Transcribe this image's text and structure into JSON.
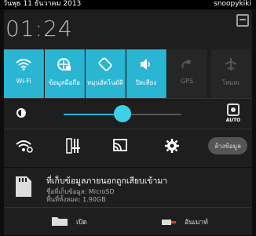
{
  "status": {
    "date": "วันพุธ 11 ธันวาคม 2013",
    "user": "snoopykiki"
  },
  "clock": "01:24",
  "toggles": [
    {
      "label": "Wi-Fi",
      "icon": "wifi-icon",
      "on": true
    },
    {
      "label": "ข้อมูลมือถือ",
      "icon": "mobile-data-icon",
      "on": true
    },
    {
      "label": "หมุนอัตโนมัติ",
      "icon": "auto-rotate-icon",
      "on": true
    },
    {
      "label": "ปิดเสียง",
      "icon": "sound-icon",
      "on": true
    },
    {
      "label": "GPS",
      "icon": "gps-icon",
      "on": false
    },
    {
      "label": "โหมดเ",
      "icon": "airplane-icon",
      "on": false
    }
  ],
  "brightness": {
    "level": 0.5,
    "auto_label": "AUTO"
  },
  "quick": {
    "chip_label": "ล้างข้อมูล"
  },
  "notification": {
    "title": "ที่เก็บข้อมูลภายนอกถูกเสียบเข้ามา",
    "line1": "ชื่อที่เก็บข้อมูล: MicroSD",
    "line2": "พื้นที่ทั้งหมด: 1.90GB",
    "open_label": "เปิด",
    "unmount_label": "อันเมาท์"
  },
  "colors": {
    "accent": "#2ab5d3",
    "panel": "#1e1e1e"
  }
}
